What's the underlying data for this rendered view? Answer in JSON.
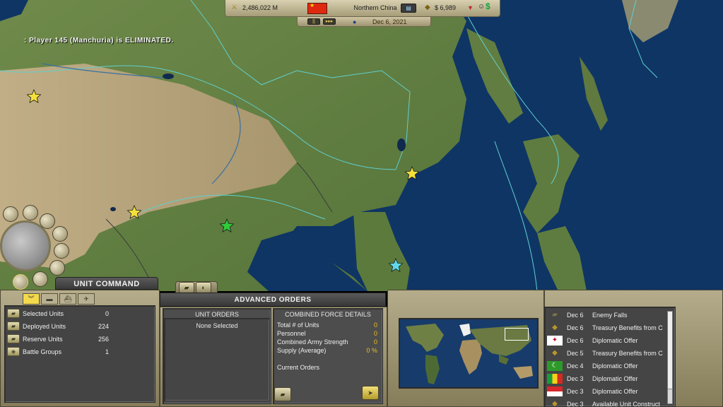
{
  "topbar": {
    "funds": "2,486,022 M",
    "nation": "Northern China",
    "cash": "$ 6,989",
    "date": "Dec 6, 2021",
    "nation_flag_color": "#de2910",
    "controls": [
      "pause-icon",
      "fast-forward-icon"
    ]
  },
  "map": {
    "message": ": Player 145 (Manchuria) is ELIMINATED.",
    "land_color": "#6f8a4a",
    "desert_color": "#b4a27c",
    "ocean_color": "#123a68",
    "border_color": "#5fd0d0",
    "city_star_colors": [
      "#f3e03a",
      "#2ecc3a",
      "#5fd8e8"
    ]
  },
  "unit_command": {
    "title": "UNIT COMMAND",
    "tabs": [
      "chevron-icon",
      "tank-icon",
      "ship-icon",
      "plane-icon"
    ],
    "rows": [
      {
        "label": "Selected Units",
        "value": "0"
      },
      {
        "label": "Deployed Units",
        "value": "224"
      },
      {
        "label": "Reserve Units",
        "value": "256"
      },
      {
        "label": "Battle Groups",
        "value": "1"
      }
    ]
  },
  "advanced_orders": {
    "title": "ADVANCED ORDERS",
    "unit_orders_header": "UNIT ORDERS",
    "unit_orders_value": "None Selected",
    "cfd_header": "COMBINED FORCE DETAILS",
    "cfd_rows": [
      {
        "label": "Total # of Units",
        "value": "0"
      },
      {
        "label": "Personnel",
        "value": "0"
      },
      {
        "label": "Combined Army Strength",
        "value": "0"
      },
      {
        "label": "Supply (Average)",
        "value": "0 %"
      }
    ],
    "current_orders": "Current Orders"
  },
  "events": [
    {
      "date": "Dec 6",
      "text": "Enemy Falls",
      "icon": "tank-icon"
    },
    {
      "date": "Dec 6",
      "text": "Treasury Benefits from C",
      "icon": "coin-icon"
    },
    {
      "date": "Dec 6",
      "text": "Diplomatic Offer",
      "icon": "wales-flag-icon"
    },
    {
      "date": "Dec 5",
      "text": "Treasury Benefits from C",
      "icon": "coin-icon"
    },
    {
      "date": "Dec 4",
      "text": "Diplomatic Offer",
      "icon": "green-flag-icon"
    },
    {
      "date": "Dec 3",
      "text": "Diplomatic Offer",
      "icon": "tricolor-flag-icon"
    },
    {
      "date": "Dec 3",
      "text": "Diplomatic Offer",
      "icon": "red-white-flag-icon"
    },
    {
      "date": "Dec 3",
      "text": "Available Unit Construct",
      "icon": "coin-icon"
    }
  ]
}
